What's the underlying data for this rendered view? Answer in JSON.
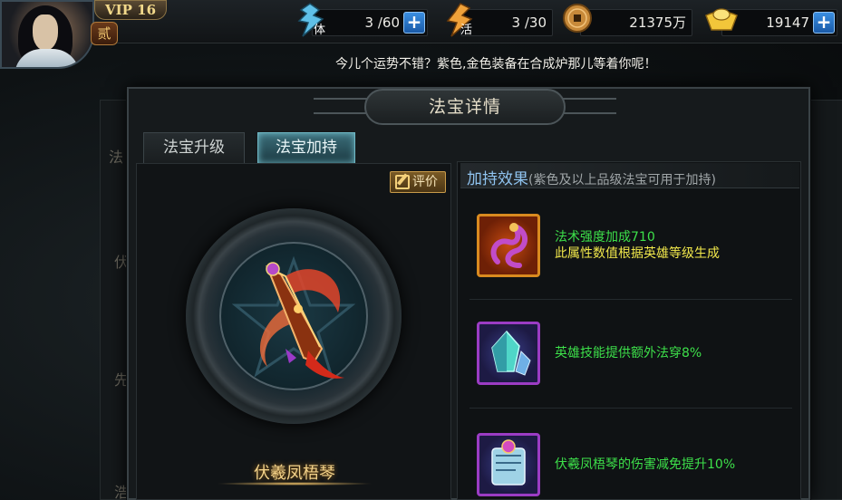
{
  "player": {
    "vip_label": "VIP 16",
    "rank_label": "贰"
  },
  "resources": {
    "stamina": {
      "icon": "stamina-icon",
      "icon_char": "体",
      "value": "3 /60"
    },
    "vigor": {
      "icon": "vigor-icon",
      "icon_char": "活",
      "value": "3 /30"
    },
    "coins": {
      "icon": "copper-coin-icon",
      "value": "21375万"
    },
    "ingots": {
      "icon": "gold-ingot-icon",
      "value": "19147"
    }
  },
  "ticker": "今儿个运势不错？紫色,金色装备在合成炉那儿等着你呢！",
  "background": {
    "ghost_chars": [
      "法",
      "伏",
      "先",
      "浩"
    ]
  },
  "dialog": {
    "title": "法宝详情",
    "tabs": [
      {
        "label": "法宝升级",
        "active": false
      },
      {
        "label": "法宝加持",
        "active": true
      }
    ],
    "rate_button": "评价",
    "item_name": "伏羲凤梧琴"
  },
  "effects": {
    "title": "加持效果",
    "subtitle": "(紫色及以上品级法宝可用于加持)",
    "items": [
      {
        "icon": "fire-serpent-icon",
        "lines": [
          "法术强度加成710",
          "此属性数值根据英雄等级生成"
        ]
      },
      {
        "icon": "crystal-icon",
        "lines": [
          "英雄技能提供额外法穿8%"
        ]
      },
      {
        "icon": "jade-scroll-icon",
        "lines": [
          "伏羲凤梧琴的伤害减免提升10%"
        ]
      }
    ]
  }
}
